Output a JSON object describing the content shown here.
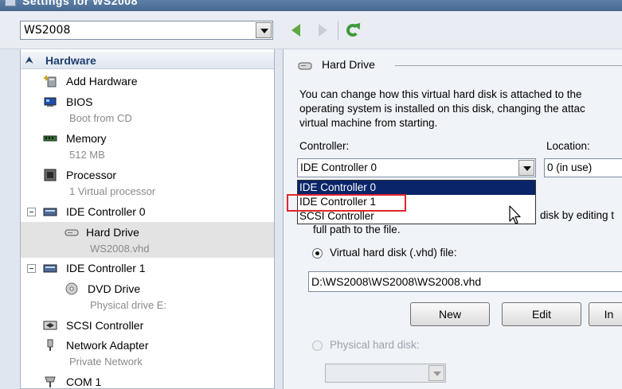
{
  "window": {
    "title": "Settings for WS2008"
  },
  "toolbar": {
    "vm_selected": "WS2008"
  },
  "sidebar": {
    "section_title": "Hardware",
    "items": [
      {
        "label": "Add Hardware",
        "icon": "add-hardware-icon"
      },
      {
        "label": "BIOS",
        "sub": "Boot from CD",
        "icon": "bios-icon"
      },
      {
        "label": "Memory",
        "sub": "512 MB",
        "icon": "memory-icon"
      },
      {
        "label": "Processor",
        "sub": "1 Virtual processor",
        "icon": "processor-icon"
      },
      {
        "label": "IDE Controller 0",
        "icon": "ide-controller-icon"
      },
      {
        "label": "Hard Drive",
        "sub": "WS2008.vhd",
        "icon": "hard-drive-icon"
      },
      {
        "label": "IDE Controller 1",
        "icon": "ide-controller-icon"
      },
      {
        "label": "DVD Drive",
        "sub": "Physical drive E:",
        "icon": "dvd-drive-icon"
      },
      {
        "label": "SCSI Controller",
        "icon": "scsi-controller-icon"
      },
      {
        "label": "Network Adapter",
        "sub": "Private Network",
        "icon": "network-adapter-icon"
      },
      {
        "label": "COM 1",
        "icon": "com-port-icon"
      }
    ]
  },
  "main": {
    "group_title": "Hard Drive",
    "description": [
      "You can change how this virtual hard disk is attached to the",
      "operating system is installed on this disk, changing the attac",
      "virtual machine from starting."
    ],
    "controller_label": "Controller:",
    "controller_value": "IDE Controller 0",
    "location_label": "Location:",
    "location_value": "0 (in use)",
    "dropdown_options": [
      "IDE Controller 0",
      "IDE Controller 1",
      "SCSI Controller"
    ],
    "hidden_text_1": "disk by editing t",
    "hidden_text_2": "full path to the file.",
    "vhd_radio_label": "Virtual hard disk (.vhd) file:",
    "vhd_path": "D:\\WS2008\\WS2008\\WS2008.vhd",
    "buttons": {
      "new": "New",
      "edit": "Edit",
      "inspect": "In"
    },
    "physical_radio_label": "Physical hard disk:"
  }
}
